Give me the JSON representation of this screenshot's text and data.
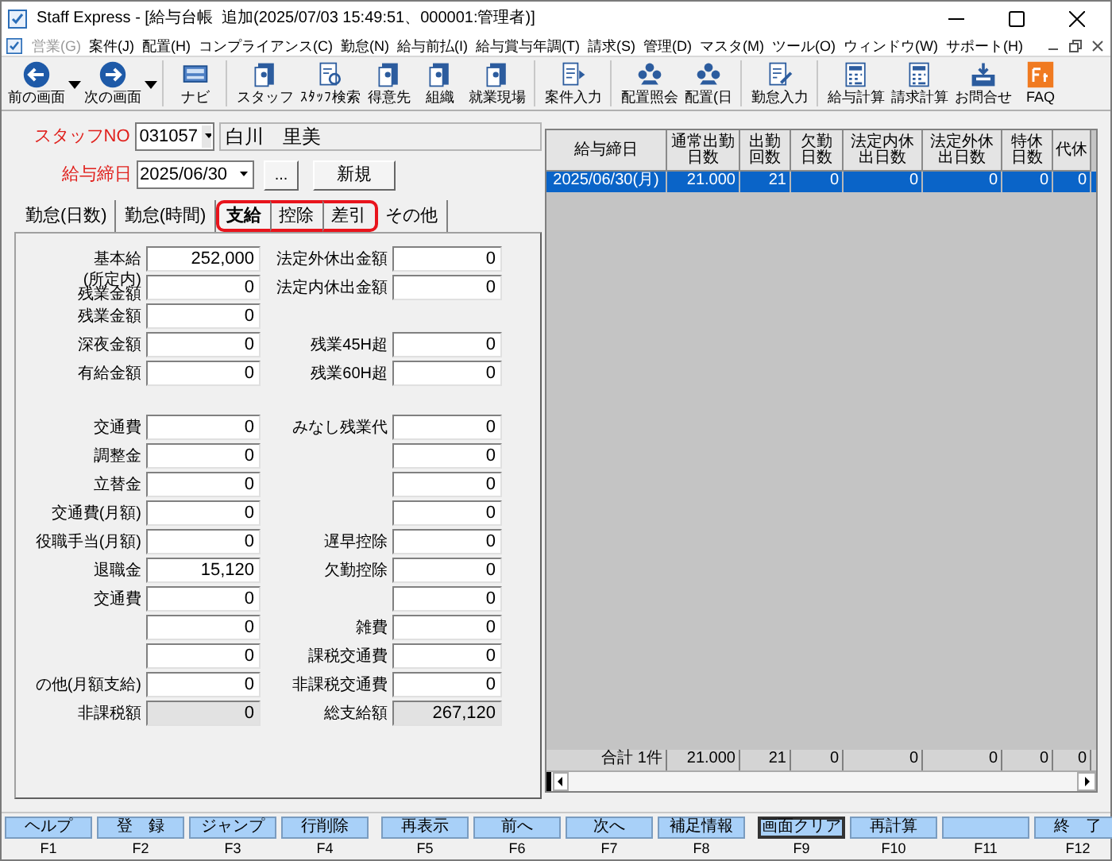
{
  "window": {
    "title": "Staff Express - [給与台帳  追加(2025/07/03 15:49:51、000001:管理者)]"
  },
  "menu": [
    {
      "label": "営業(G)",
      "disabled": true
    },
    {
      "label": "案件(J)",
      "disabled": false
    },
    {
      "label": "配置(H)",
      "disabled": false
    },
    {
      "label": "コンプライアンス(C)",
      "disabled": false
    },
    {
      "label": "勤怠(N)",
      "disabled": false
    },
    {
      "label": "給与前払(I)",
      "disabled": false
    },
    {
      "label": "給与賞与年調(T)",
      "disabled": false
    },
    {
      "label": "請求(S)",
      "disabled": false
    },
    {
      "label": "管理(D)",
      "disabled": false
    },
    {
      "label": "マスタ(M)",
      "disabled": false
    },
    {
      "label": "ツール(O)",
      "disabled": false
    },
    {
      "label": "ウィンドウ(W)",
      "disabled": false
    },
    {
      "label": "サポート(H)",
      "disabled": false
    }
  ],
  "toolbar": [
    {
      "label": "前の画面",
      "kind": "back",
      "dropdown": true,
      "separator_before": false
    },
    {
      "label": "次の画面",
      "kind": "forward",
      "dropdown": true,
      "separator_before": false
    },
    {
      "label": "ナビ",
      "kind": "navi",
      "dropdown": false,
      "separator_before": true
    },
    {
      "label": "スタッフ",
      "kind": "doc",
      "dropdown": false,
      "separator_before": true
    },
    {
      "label": "ｽﾀｯﾌ検索",
      "kind": "search",
      "dropdown": false,
      "separator_before": false
    },
    {
      "label": "得意先",
      "kind": "doc",
      "dropdown": false,
      "separator_before": false
    },
    {
      "label": "組織",
      "kind": "doc",
      "dropdown": false,
      "separator_before": false
    },
    {
      "label": "就業現場",
      "kind": "doc",
      "dropdown": false,
      "separator_before": false
    },
    {
      "label": "案件入力",
      "kind": "entry",
      "dropdown": false,
      "separator_before": true
    },
    {
      "label": "配置照会",
      "kind": "people",
      "dropdown": false,
      "separator_before": true
    },
    {
      "label": "配置(日",
      "kind": "people",
      "dropdown": false,
      "separator_before": false
    },
    {
      "label": "勤怠入力",
      "kind": "edit",
      "dropdown": false,
      "separator_before": true
    },
    {
      "label": "給与計算",
      "kind": "calc",
      "dropdown": false,
      "separator_before": true
    },
    {
      "label": "請求計算",
      "kind": "calc",
      "dropdown": false,
      "separator_before": false
    },
    {
      "label": "お問合せ",
      "kind": "inbox",
      "dropdown": false,
      "separator_before": false
    },
    {
      "label": "FAQ",
      "kind": "faq",
      "dropdown": false,
      "separator_before": false
    }
  ],
  "staff": {
    "label": "スタッフNO",
    "number": "031057",
    "name": "白川　里美"
  },
  "closing_date": {
    "label": "給与締日",
    "value": "2025/06/30",
    "browse_button": "...",
    "new_button": "新規"
  },
  "tabs": [
    {
      "label": "勤怠(日数)",
      "selected": false,
      "highlighted": false
    },
    {
      "label": "勤怠(時間)",
      "selected": false,
      "highlighted": false
    },
    {
      "label": "支給",
      "selected": true,
      "highlighted": true
    },
    {
      "label": "控除",
      "selected": false,
      "highlighted": true
    },
    {
      "label": "差引",
      "selected": false,
      "highlighted": true
    },
    {
      "label": "その他",
      "selected": false,
      "highlighted": false
    }
  ],
  "form_groups": [
    [
      {
        "left": {
          "label": "基本給",
          "value": "252,000",
          "readonly": false
        },
        "right": {
          "label": "法定外休出金額",
          "value": "0",
          "readonly": false
        }
      },
      {
        "left": {
          "label": "(所定内)\n残業金額",
          "value": "0",
          "readonly": false
        },
        "right": {
          "label": "法定内休出金額",
          "value": "0",
          "readonly": false
        }
      },
      {
        "left": {
          "label": "残業金額",
          "value": "0",
          "readonly": false
        }
      },
      {
        "left": {
          "label": "深夜金額",
          "value": "0",
          "readonly": false
        },
        "right": {
          "label": "残業45H超",
          "value": "0",
          "readonly": false
        }
      },
      {
        "left": {
          "label": "有給金額",
          "value": "0",
          "readonly": false
        },
        "right": {
          "label": "残業60H超",
          "value": "0",
          "readonly": false
        }
      }
    ],
    [
      {
        "left": {
          "label": "交通費",
          "value": "0",
          "readonly": false
        },
        "right": {
          "label": "みなし残業代",
          "value": "0",
          "readonly": false
        }
      },
      {
        "left": {
          "label": "調整金",
          "value": "0",
          "readonly": false
        },
        "right": {
          "value": "0",
          "readonly": false
        }
      },
      {
        "left": {
          "label": "立替金",
          "value": "0",
          "readonly": false
        },
        "right": {
          "value": "0",
          "readonly": false
        }
      },
      {
        "left": {
          "label": "交通費(月額)",
          "value": "0",
          "readonly": false
        },
        "right": {
          "value": "0",
          "readonly": false
        }
      },
      {
        "left": {
          "label": "役職手当(月額)",
          "value": "0",
          "readonly": false
        },
        "right": {
          "label": "遅早控除",
          "value": "0",
          "readonly": false
        }
      },
      {
        "left": {
          "label": "退職金",
          "value": "15,120",
          "readonly": false
        },
        "right": {
          "label": "欠勤控除",
          "value": "0",
          "readonly": false
        }
      },
      {
        "left": {
          "label": "交通費",
          "value": "0",
          "readonly": false
        },
        "right": {
          "value": "0",
          "readonly": false
        }
      },
      {
        "left": {
          "value": "0",
          "readonly": false
        },
        "right": {
          "label": "雑費",
          "value": "0",
          "readonly": false
        }
      },
      {
        "left": {
          "value": "0",
          "readonly": false
        },
        "right": {
          "label": "課税交通費",
          "value": "0",
          "readonly": false
        }
      },
      {
        "left": {
          "label": "の他(月額支給)",
          "value": "0",
          "readonly": false
        },
        "right": {
          "label": "非課税交通費",
          "value": "0",
          "readonly": false
        }
      },
      {
        "left": {
          "label": "非課税額",
          "value": "0",
          "readonly": true
        },
        "right": {
          "label": "総支給額",
          "value": "267,120",
          "readonly": true
        }
      }
    ]
  ],
  "grid": {
    "columns": [
      "給与締日",
      "通常出勤日数",
      "出勤回数",
      "欠勤日数",
      "法定内休出日数",
      "法定外休出日数",
      "特休日数",
      "代休"
    ],
    "rows": [
      {
        "cells": [
          "2025/06/30(月)",
          "21.000",
          "21",
          "0",
          "0",
          "0",
          "0",
          "0"
        ],
        "selected": true
      }
    ],
    "totals": [
      "合計 1件",
      "21.000",
      "21",
      "0",
      "0",
      "0",
      "0",
      "0"
    ]
  },
  "function_keys": [
    [
      {
        "label": "ヘルプ",
        "key": "F1",
        "focused": false
      },
      {
        "label": "登　録",
        "key": "F2",
        "focused": false
      },
      {
        "label": "ジャンプ",
        "key": "F3",
        "focused": false
      },
      {
        "label": "行削除",
        "key": "F4",
        "focused": false
      }
    ],
    [
      {
        "label": "再表示",
        "key": "F5",
        "focused": false
      },
      {
        "label": "前へ",
        "key": "F6",
        "focused": false
      },
      {
        "label": "次へ",
        "key": "F7",
        "focused": false
      },
      {
        "label": "補足情報",
        "key": "F8",
        "focused": false
      }
    ],
    [
      {
        "label": "画面クリア",
        "key": "F9",
        "focused": true
      },
      {
        "label": "再計算",
        "key": "F10",
        "focused": false
      },
      {
        "key": "F11",
        "focused": false
      },
      {
        "label": "終　了",
        "key": "F12",
        "focused": false
      }
    ]
  ]
}
